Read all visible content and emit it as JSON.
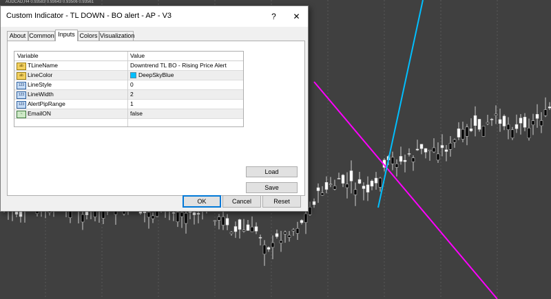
{
  "chart": {
    "header_text": "AUDCAD,H4  0.93583 0.93643 0.93506 0.93561",
    "background": "#404040",
    "up_color": "#ffffff",
    "down_color": "#000000",
    "trendline_color": "#ff00ff",
    "steep_line_color": "#00bfff"
  },
  "dialog": {
    "title": "Custom Indicator - TL DOWN - BO alert - AP - V3",
    "window_buttons": {
      "help": "?",
      "close": "✕"
    },
    "tabs": [
      {
        "label": "About",
        "active": false
      },
      {
        "label": "Common",
        "active": false
      },
      {
        "label": "Inputs",
        "active": true
      },
      {
        "label": "Colors",
        "active": false
      },
      {
        "label": "Visualization",
        "active": false
      }
    ],
    "table": {
      "headers": {
        "variable": "Variable",
        "value": "Value"
      },
      "rows": [
        {
          "icon": "ab",
          "type_icon": "string-icon",
          "variable": "TLineName",
          "value": "Downtrend TL BO - Rising Price Alert"
        },
        {
          "icon": "ab",
          "type_icon": "color-icon",
          "variable": "LineColor",
          "value": "DeepSkyBlue",
          "swatch": "#00bfff"
        },
        {
          "icon": "123",
          "type_icon": "integer-icon",
          "variable": "LineStyle",
          "value": "0"
        },
        {
          "icon": "123",
          "type_icon": "integer-icon",
          "variable": "LineWidth",
          "value": "2"
        },
        {
          "icon": "123",
          "type_icon": "integer-icon",
          "variable": "AlertPipRange",
          "value": "1"
        },
        {
          "icon": "~",
          "type_icon": "bool-icon",
          "variable": "EmailON",
          "value": "false"
        }
      ]
    },
    "buttons": {
      "load": "Load",
      "save": "Save",
      "ok": "OK",
      "cancel": "Cancel",
      "reset": "Reset"
    }
  }
}
